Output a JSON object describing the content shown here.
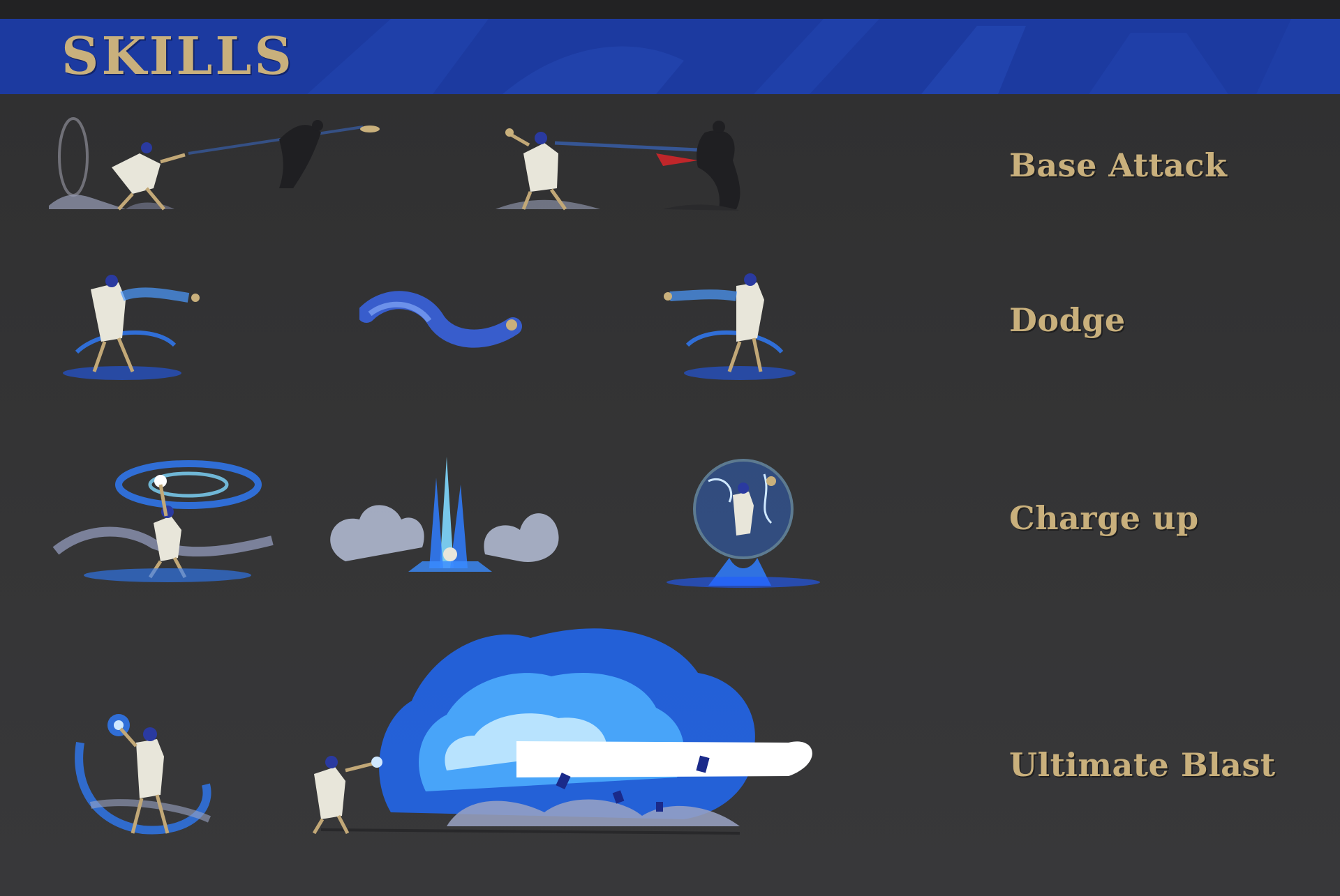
{
  "banner": {
    "title": "SKILLS",
    "color": "#1c3aa0",
    "title_color": "#c9b07c"
  },
  "skills": [
    {
      "label": "Base Attack",
      "frames": [
        "attack-windup",
        "attack-throw",
        "attack-hit"
      ]
    },
    {
      "label": "Dodge",
      "frames": [
        "dodge-start",
        "dodge-dash",
        "dodge-end"
      ]
    },
    {
      "label": "Charge up",
      "frames": [
        "charge-swirl",
        "charge-burst",
        "charge-orb"
      ]
    },
    {
      "label": "Ultimate Blast",
      "frames": [
        "ultimate-gather",
        "ultimate-blast"
      ]
    }
  ],
  "palette": {
    "background": "#333333",
    "energy_blue": "#2f7dff",
    "energy_cyan": "#7fd8ff",
    "cloak": "#e8e6da",
    "smoke": "#9aa3c4",
    "shadow": "#1a1a1b",
    "blood": "#c0262a"
  }
}
